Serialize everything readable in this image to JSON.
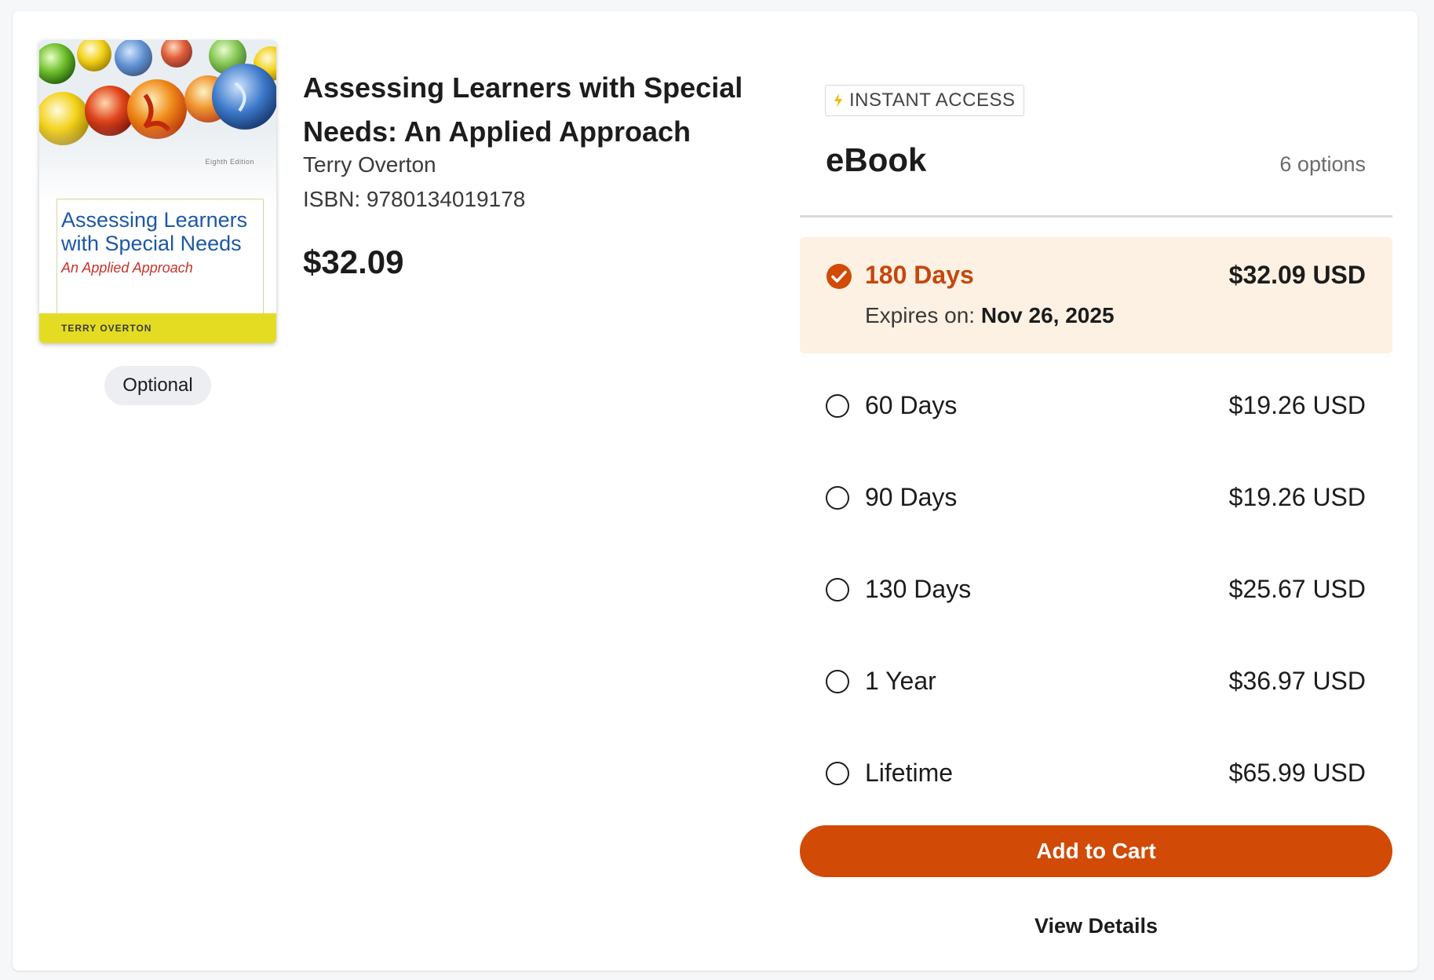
{
  "book": {
    "cover": {
      "edition": "Eighth Edition",
      "title": "Assessing Learners with Special Needs",
      "subtitle": "An Applied Approach",
      "author": "TERRY OVERTON",
      "colors": {
        "title": "#1d57a8",
        "subtitle": "#c8322b",
        "band": "#e4dc22"
      }
    },
    "badge": "Optional",
    "title": "Assessing Learners with Special Needs: An Applied Approach",
    "author": "Terry Overton",
    "isbn": "ISBN: 9780134019178",
    "price": "$32.09"
  },
  "format": {
    "tag": "INSTANT ACCESS",
    "tag_icon": "bolt-icon",
    "name": "eBook",
    "options_count": "6 options"
  },
  "options": [
    {
      "label": "180 Days",
      "price": "$32.09 USD",
      "selected": true,
      "expiry_label": "Expires on:",
      "expiry_date": "Nov 26, 2025"
    },
    {
      "label": "60 Days",
      "price": "$19.26 USD",
      "selected": false
    },
    {
      "label": "90 Days",
      "price": "$19.26 USD",
      "selected": false
    },
    {
      "label": "130 Days",
      "price": "$25.67 USD",
      "selected": false
    },
    {
      "label": "1 Year",
      "price": "$36.97 USD",
      "selected": false
    },
    {
      "label": "Lifetime",
      "price": "$65.99 USD",
      "selected": false
    }
  ],
  "actions": {
    "add_to_cart": "Add to Cart",
    "view_details": "View Details"
  },
  "colors": {
    "accent": "#d14a06",
    "selected_bg": "#fdf1e3",
    "selected_text": "#c4470d"
  }
}
